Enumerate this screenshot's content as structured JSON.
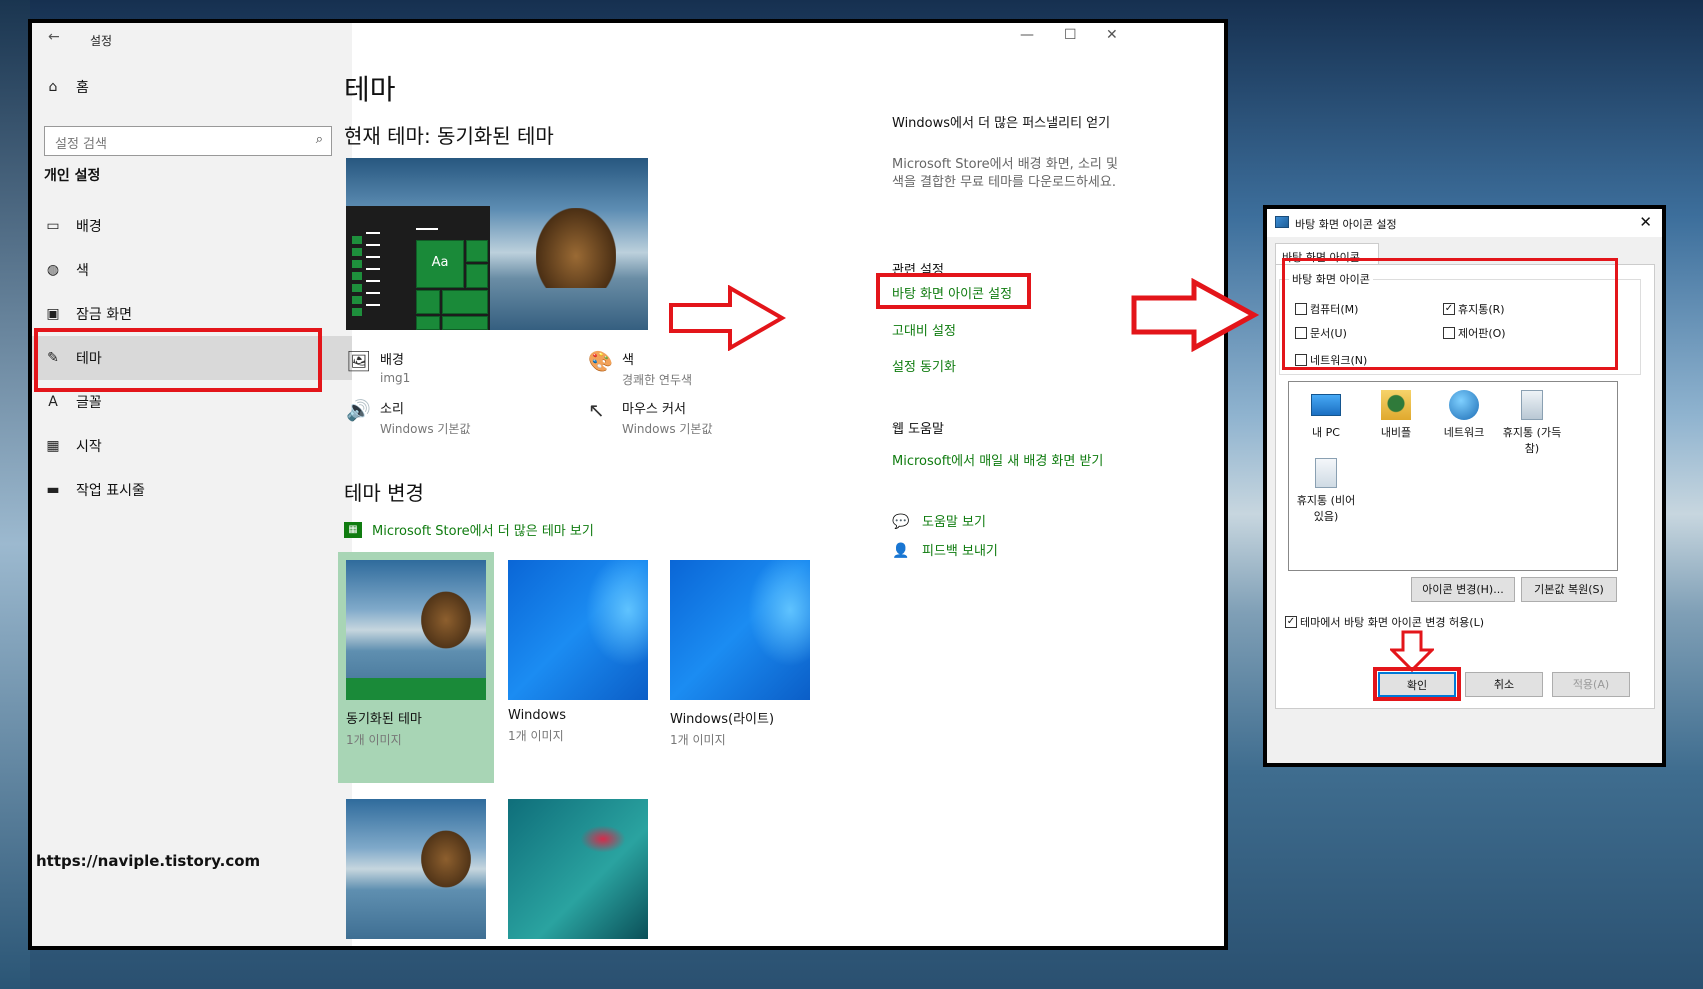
{
  "settings": {
    "app_title": "설정",
    "home": "홈",
    "search_placeholder": "설정 검색",
    "group": "개인 설정",
    "nav": [
      "배경",
      "색",
      "잠금 화면",
      "테마",
      "글꼴",
      "시작",
      "작업 표시줄"
    ],
    "selected_nav": "테마"
  },
  "main": {
    "title": "테마",
    "current_theme": "현재 테마: 동기화된 테마",
    "props": {
      "background_label": "배경",
      "background_value": "img1",
      "color_label": "색",
      "color_value": "경쾌한 연두색",
      "sound_label": "소리",
      "sound_value": "Windows 기본값",
      "cursor_label": "마우스 커서",
      "cursor_value": "Windows 기본값"
    },
    "preview_tile": "Aa",
    "change_theme": "테마 변경",
    "store_link": "Microsoft Store에서 더 많은 테마 보기",
    "themes": [
      {
        "name": "동기화된 테마",
        "count": "1개 이미지"
      },
      {
        "name": "Windows",
        "count": "1개 이미지"
      },
      {
        "name": "Windows(라이트)",
        "count": "1개 이미지"
      }
    ]
  },
  "right": {
    "personality_title": "Windows에서 더 많은 퍼스낼리티 얻기",
    "personality_desc": "Microsoft Store에서 배경 화면, 소리 및 색을 결합한 무료 테마를 다운로드하세요.",
    "related_title": "관련 설정",
    "desktop_icon_link": "바탕 화면 아이콘 설정",
    "high_contrast_link": "고대비 설정",
    "sync_link": "설정 동기화",
    "web_help_title": "웹 도움말",
    "web_help_link": "Microsoft에서 매일 새 배경 화면 받기",
    "help_link": "도움말 보기",
    "feedback_link": "피드백 보내기"
  },
  "dialog": {
    "title": "바탕 화면 아이콘 설정",
    "tab": "바탕 화면 아이콘",
    "fieldset": "바탕 화면 아이콘",
    "checks": {
      "computer": "컴퓨터(M)",
      "recycle": "휴지통(R)",
      "documents": "문서(U)",
      "control": "제어판(O)",
      "network": "네트워크(N)"
    },
    "checked": {
      "computer": false,
      "recycle": true,
      "documents": false,
      "control": false,
      "network": false
    },
    "icons": [
      "내 PC",
      "내비플",
      "네트워크",
      "휴지통 (가득 참)",
      "휴지통 (비어 있음)"
    ],
    "change_icon": "아이콘 변경(H)...",
    "restore": "기본값 복원(S)",
    "allow_themes": "테마에서 바탕 화면 아이콘 변경 허용(L)",
    "allow_checked": true,
    "ok": "확인",
    "cancel": "취소",
    "apply": "적용(A)"
  },
  "watermark": "https://naviple.tistory.com",
  "colors": {
    "accent_green": "#107c10",
    "highlight_red": "#e3151a"
  }
}
